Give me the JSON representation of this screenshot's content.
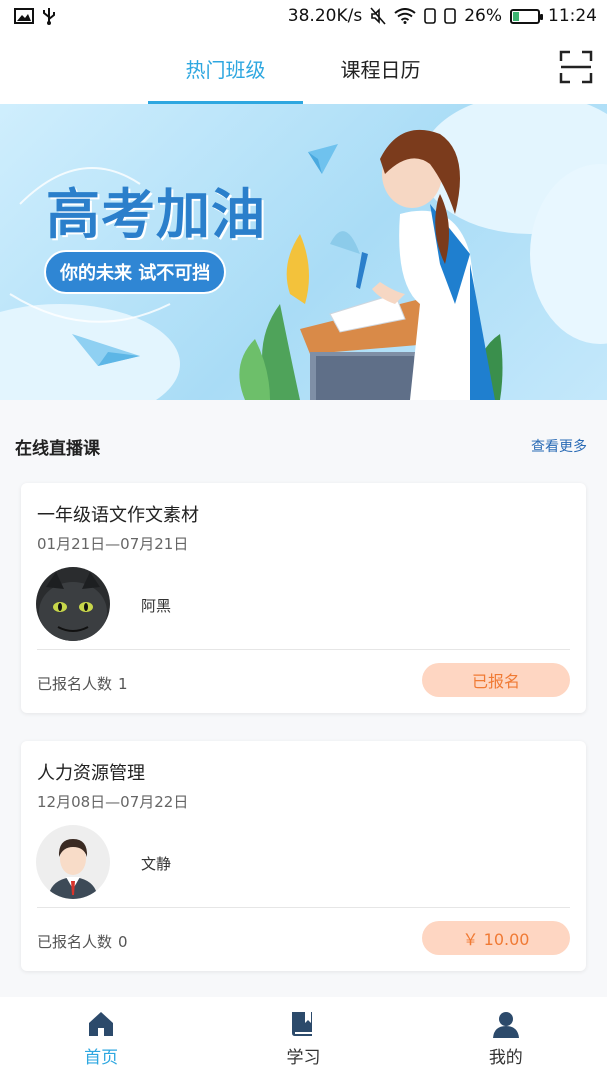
{
  "status_bar": {
    "speed": "38.20K/s",
    "battery": "26%",
    "battery_level": 0.26,
    "time": "11:24",
    "icons": [
      "image-icon",
      "usb-icon",
      "mute-icon",
      "wifi-icon",
      "sim-icon",
      "sim-icon",
      "battery-icon"
    ]
  },
  "header": {
    "tabs": [
      {
        "label": "热门班级",
        "active": true
      },
      {
        "label": "课程日历",
        "active": false
      }
    ],
    "scan_icon": "scan-icon"
  },
  "banner": {
    "title": "高考加油",
    "subtitle": "你的未来 试不可挡"
  },
  "section": {
    "title": "在线直播课",
    "more": "查看更多"
  },
  "courses": [
    {
      "title": "一年级语文作文素材",
      "date": "01月21日—07月21日",
      "teacher": "阿黑",
      "enroll_label": "已报名人数",
      "enroll_count": "1",
      "action": "已报名"
    },
    {
      "title": "人力资源管理",
      "date": "12月08日—07月22日",
      "teacher": "文静",
      "enroll_label": "已报名人数",
      "enroll_count": "0",
      "action": "￥ 10.00"
    }
  ],
  "bottom_nav": [
    {
      "label": "首页",
      "icon": "home-icon",
      "active": true
    },
    {
      "label": "学习",
      "icon": "book-icon",
      "active": false
    },
    {
      "label": "我的",
      "icon": "user-icon",
      "active": false
    }
  ],
  "colors": {
    "accent": "#2ea7e0",
    "button_bg": "#fed6c2",
    "button_text": "#f07a34",
    "banner_blue": "#2f86d4"
  }
}
